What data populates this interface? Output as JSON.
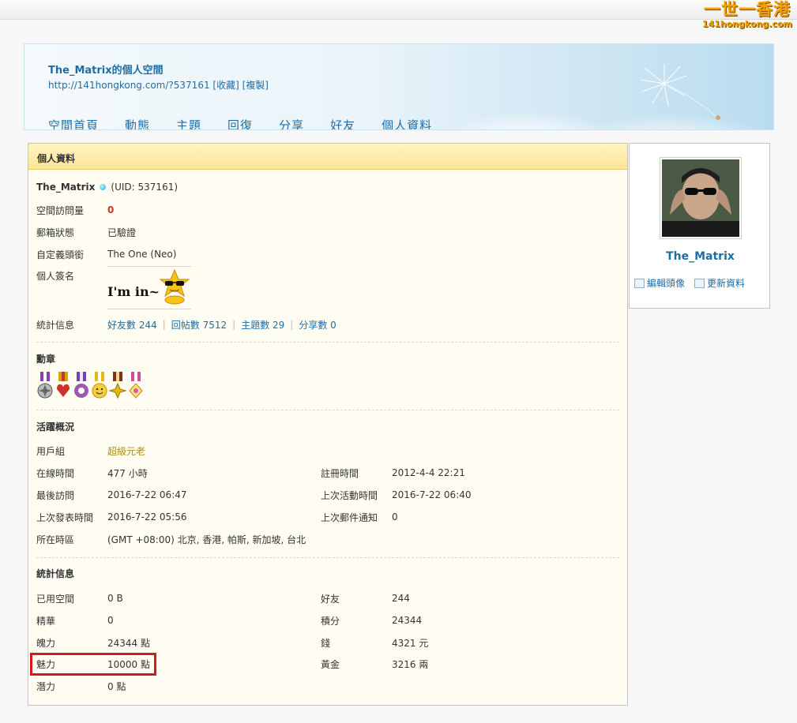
{
  "site": {
    "logo_line1": "一世一香港",
    "logo_line2": "141hongkong.com"
  },
  "space": {
    "title": "The_Matrix的個人空間",
    "url": "http://141hongkong.com/?537161",
    "bookmark": "[收藏]",
    "copy": "[複製]"
  },
  "nav": [
    "空間首頁",
    "動態",
    "主題",
    "回復",
    "分享",
    "好友",
    "個人資料"
  ],
  "profile": {
    "header": "個人資料",
    "username": "The_Matrix",
    "uid": "(UID: 537161)",
    "visits_label": "空間訪問量",
    "visits_value": "0",
    "email_label": "郵箱狀態",
    "email_value": "已驗證",
    "title_label": "自定義頭銜",
    "title_value": "The One (Neo)",
    "signature_label": "個人簽名",
    "signature_text": "I'm in~",
    "stats_label": "統計信息",
    "stats_links": [
      "好友數 244",
      "回帖數 7512",
      "主題數 29",
      "分享數 0"
    ]
  },
  "medals": {
    "title": "勳章",
    "colors": [
      "#8a3fb8",
      "#d9a20f",
      "#7b3fb5",
      "#e8b80f",
      "#7a3320",
      "#d24da0"
    ]
  },
  "activity": {
    "title": "活躍概況",
    "group_label": "用戶組",
    "group_value": "超級元老",
    "group_color": "#b08a1c",
    "left": [
      {
        "label": "在線時間",
        "value": "477 小時"
      },
      {
        "label": "最後訪問",
        "value": "2016-7-22 06:47"
      },
      {
        "label": "上次發表時間",
        "value": "2016-7-22 05:56"
      },
      {
        "label": "所在時區",
        "value": "(GMT +08:00) 北京, 香港, 帕斯, 新加坡, 台北"
      }
    ],
    "right": [
      {
        "label": "註冊時間",
        "value": "2012-4-4 22:21"
      },
      {
        "label": "上次活動時間",
        "value": "2016-7-22 06:40"
      },
      {
        "label": "上次郵件通知",
        "value": "0"
      }
    ]
  },
  "stats": {
    "title": "統計信息",
    "left": [
      {
        "label": "已用空間",
        "value": "0 B"
      },
      {
        "label": "精華",
        "value": "0"
      },
      {
        "label": "魄力",
        "value": "24344 點"
      },
      {
        "label": "魅力",
        "value": "10000 點"
      },
      {
        "label": "潛力",
        "value": "0 點"
      }
    ],
    "right": [
      {
        "label": "好友",
        "value": "244"
      },
      {
        "label": "積分",
        "value": "24344"
      },
      {
        "label": "錢",
        "value": "4321 元"
      },
      {
        "label": "黃金",
        "value": "3216 兩"
      }
    ]
  },
  "sidebar": {
    "username": "The_Matrix",
    "edit_avatar": "編輯頭像",
    "update_profile": "更新資料"
  },
  "colors": {
    "link": "#1f6da3",
    "highlight": "#d6181f",
    "header_bg": "#fde69a"
  }
}
